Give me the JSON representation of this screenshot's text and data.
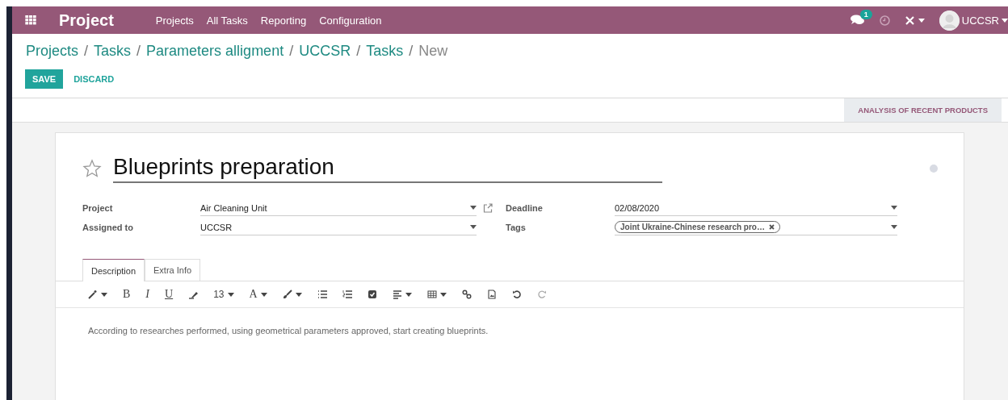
{
  "navbar": {
    "app_name": "Project",
    "menu": [
      "Projects",
      "All Tasks",
      "Reporting",
      "Configuration"
    ],
    "messages_count": "1",
    "user": "UCCSR"
  },
  "breadcrumbs": [
    {
      "label": "Projects",
      "current": false
    },
    {
      "separator": "/",
      "label": "Tasks",
      "current": false
    },
    {
      "separator": "/",
      "label": "Parameters alligment",
      "current": false
    },
    {
      "separator": "/",
      "label": "UCCSR",
      "current": false
    },
    {
      "separator": "/",
      "label": "Tasks",
      "current": false
    },
    {
      "separator": "/",
      "label": "New",
      "current": true
    }
  ],
  "buttons": {
    "save": "SAVE",
    "discard": "DISCARD"
  },
  "side_tab": "ANALYSIS OF RECENT PRODUCTS",
  "task": {
    "title": "Blueprints preparation",
    "starred": false,
    "fields_left": [
      {
        "label": "Project",
        "value": "Air Cleaning Unit",
        "external_link": true
      },
      {
        "label": "Assigned to",
        "value": "UCCSR",
        "external_link": false
      }
    ],
    "fields_right": [
      {
        "label": "Deadline",
        "value": "02/08/2020",
        "kind": "text"
      },
      {
        "label": "Tags",
        "kind": "tags",
        "tags": [
          "Joint Ukraine-Chinese research pro…"
        ]
      }
    ]
  },
  "tabs": [
    {
      "label": "Description",
      "selected": true
    },
    {
      "label": "Extra Info",
      "selected": false
    }
  ],
  "editor_toolbar": {
    "bold": "B",
    "italic": "I",
    "underline": "U",
    "font_size": "13",
    "font_color": "A"
  },
  "description": "According to researches performed, using geometrical parameters approved, start creating blueprints."
}
